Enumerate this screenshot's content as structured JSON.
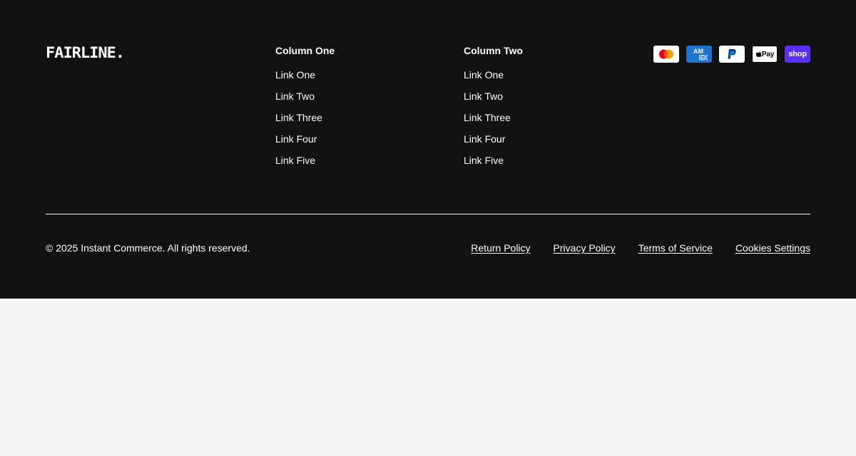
{
  "brand": {
    "logo_text": "FAIRLINE."
  },
  "columns": [
    {
      "title": "Column One",
      "links": [
        "Link One",
        "Link Two",
        "Link Three",
        "Link Four",
        "Link Five"
      ]
    },
    {
      "title": "Column Two",
      "links": [
        "Link One",
        "Link Two",
        "Link Three",
        "Link Four",
        "Link Five"
      ]
    }
  ],
  "payments": [
    {
      "name": "mastercard-icon"
    },
    {
      "name": "amex-icon"
    },
    {
      "name": "paypal-icon"
    },
    {
      "name": "apple-pay-icon",
      "label": "Pay"
    },
    {
      "name": "shop-pay-icon",
      "label": "shop"
    }
  ],
  "footer": {
    "copyright": "© 2025 Instant Commerce. All rights reserved.",
    "legal_links": [
      "Return Policy",
      "Privacy Policy",
      "Terms of Service",
      "Cookies Settings"
    ]
  },
  "colors": {
    "footer_bg": "#111111",
    "page_bg": "#f3f4f6",
    "text": "#ffffff",
    "amex_blue": "#1f72cd",
    "shop_purple": "#5a31f4"
  }
}
